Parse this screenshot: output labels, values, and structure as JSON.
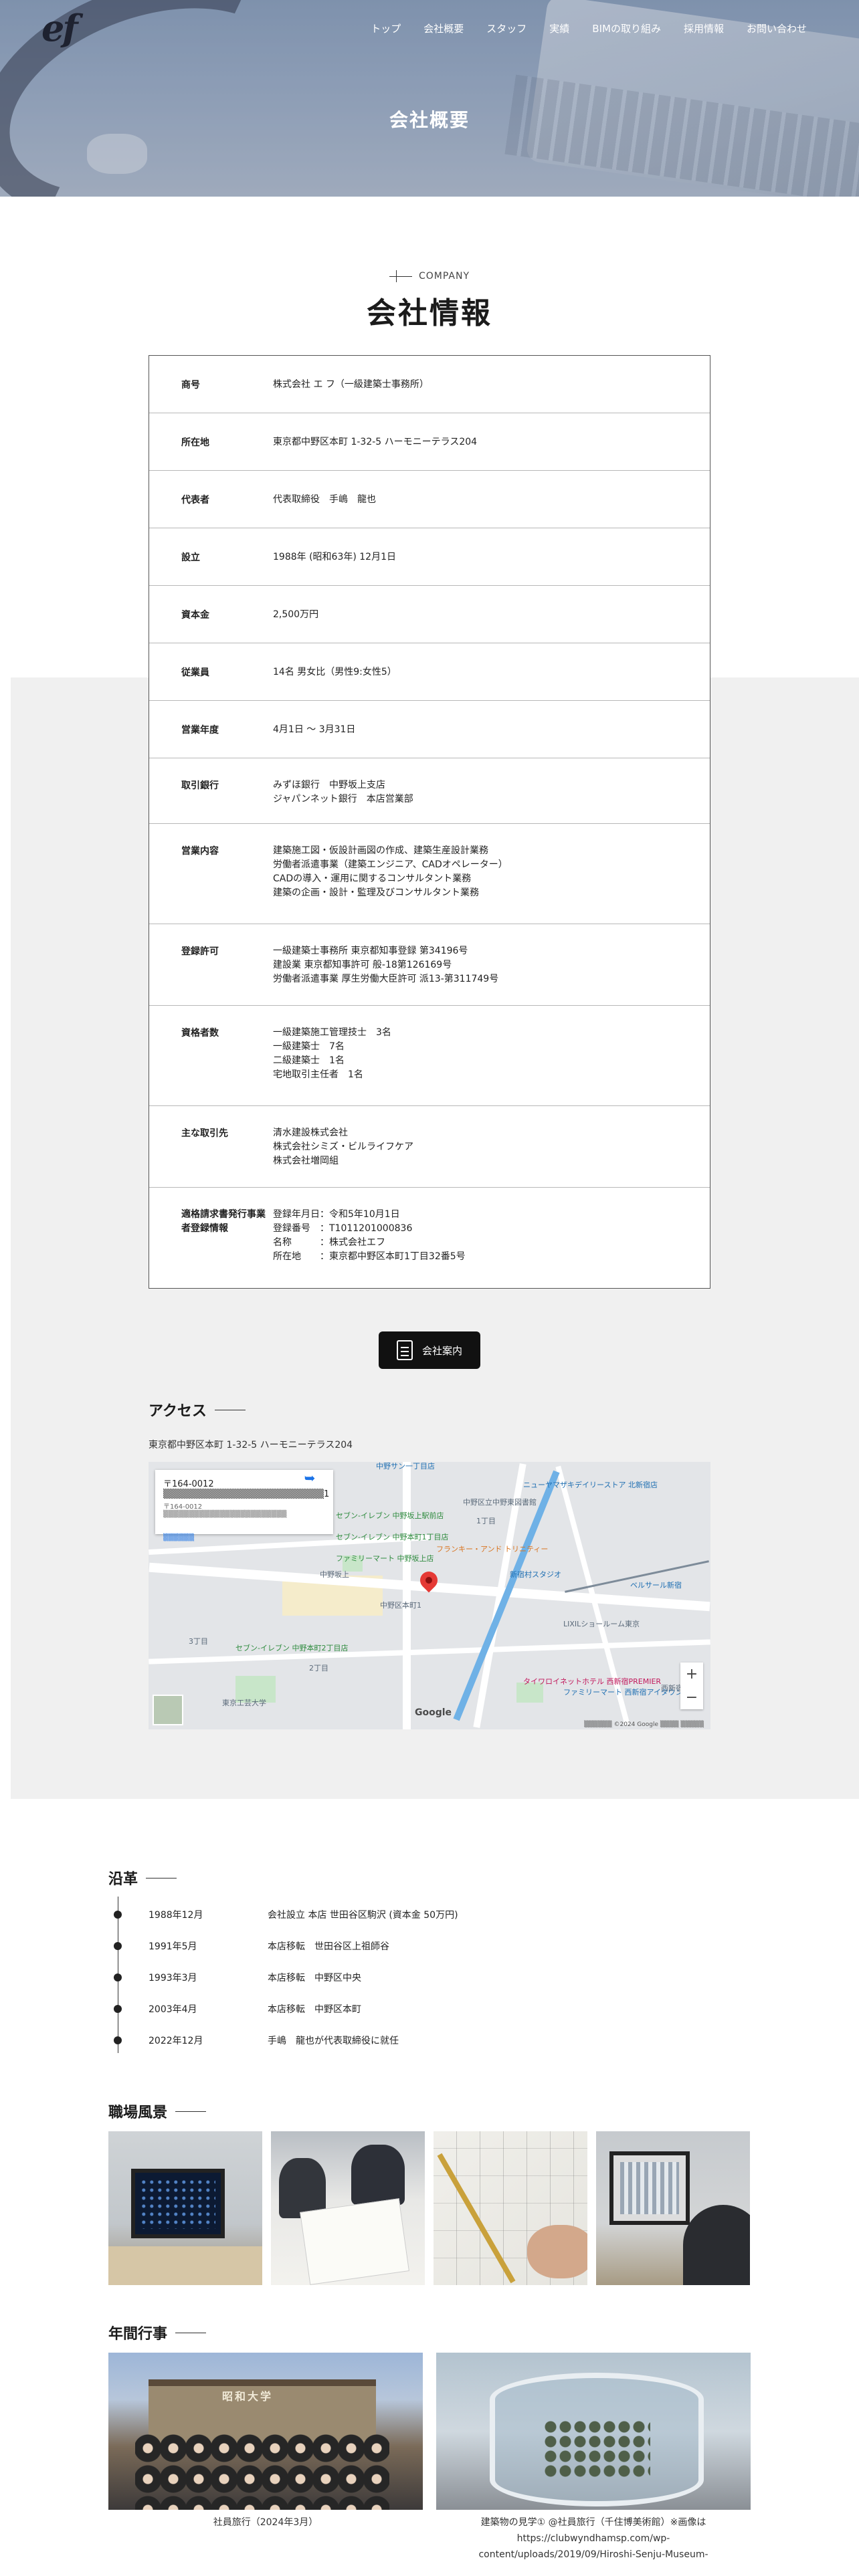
{
  "header": {
    "logo": "ef",
    "nav": [
      "トップ",
      "会社概要",
      "スタッフ",
      "実績",
      "BIMの取り組み",
      "採用情報",
      "お問い合わせ"
    ],
    "hero_title": "会社概要"
  },
  "company": {
    "eyebrow": "COMPANY",
    "title": "会社情報",
    "rows": [
      {
        "label": "商号",
        "lines": [
          "株式会社 エ フ（一級建築士事務所）"
        ]
      },
      {
        "label": "所在地",
        "lines": [
          "東京都中野区本町 1-32-5 ハーモニーテラス204"
        ]
      },
      {
        "label": "代表者",
        "lines": [
          "代表取締役　手嶋　龍也"
        ]
      },
      {
        "label": "設立",
        "lines": [
          "1988年 (昭和63年) 12月1日"
        ]
      },
      {
        "label": "資本金",
        "lines": [
          "2,500万円"
        ]
      },
      {
        "label": "従業員",
        "lines": [
          "14名 男女比（男性9:女性5）"
        ]
      },
      {
        "label": "営業年度",
        "lines": [
          "4月1日 ～ 3月31日"
        ]
      },
      {
        "label": "取引銀行",
        "lines": [
          "みずほ銀行　中野坂上支店",
          "ジャパンネット銀行　本店営業部"
        ]
      },
      {
        "label": "営業内容",
        "lines": [
          "建築施工図・仮設計画図の作成、建築生産設計業務",
          "労働者派遣事業（建築エンジニア、CADオペレーター）",
          "CADの導入・運用に関するコンサルタント業務",
          "建築の企画・設計・監理及びコンサルタント業務"
        ]
      },
      {
        "label": "登録許可",
        "lines": [
          "一級建築士事務所 東京都知事登録 第34196号",
          "建設業 東京都知事許可 般-18第126169号",
          "労働者派遣事業 厚生労働大臣許可 派13-第311749号"
        ]
      },
      {
        "label": "資格者数",
        "lines": [
          "一級建築施工管理技士　3名",
          "一級建築士　7名",
          "二級建築士　1名",
          "宅地取引主任者　1名"
        ]
      },
      {
        "label": "主な取引先",
        "lines": [
          "清水建設株式会社",
          "株式会社シミズ・ビルライフケア",
          "株式会社増岡組"
        ]
      },
      {
        "label": "適格請求書発行事業者登録情報",
        "lines": [
          "登録年月日：令和5年10月1日",
          "登録番号　：T1011201000836",
          "名称　　　：株式会社エフ",
          "所在地　　：東京都中野区本町1丁目32番5号"
        ]
      }
    ],
    "button_label": "会社案内"
  },
  "access": {
    "title": "アクセス",
    "address": "東京都中野区本町 1-32-5 ハーモニーテラス204",
    "map": {
      "card_title": "〒164-0012 ▒▒▒▒▒▒▒▒▒▒▒▒▒▒▒▒▒▒▒▒▒▒▒▒1",
      "card_sub": "〒164-0012 ▒▒▒▒▒▒▒▒▒▒▒▒▒▒▒▒▒▒▒▒▒▒▒▒",
      "card_link": "▒▒▒▒▒▒",
      "labels": [
        "中野サン一丁目店",
        "ニューヤマザキデイリーストア 北新宿店",
        "セブン-イレブン 中野坂上駅前店",
        "セブン-イレブン 中野本町1丁目店",
        "ファミリーマート 中野坂上店",
        "フランキー・アンド トリニティー",
        "中野坂上",
        "東京工芸大学",
        "タイワロイネットホテル 西新宿PREMIER",
        "ファミリーマート 西新宿アイタウン店",
        "ベルサール新宿",
        "中野区立中野東図書館",
        "新宿村スタジオ",
        "LIXILショールーム東京",
        "セブン-イレブン 中野本町2丁目店",
        "1丁目",
        "2丁目",
        "3丁目",
        "中野区本町1",
        "西新宿"
      ],
      "brand": "Google",
      "footer": "▒▒▒▒▒▒ ©2024 Google ▒▒▒▒ ▒▒▒▒▒"
    }
  },
  "history": {
    "title": "沿革",
    "items": [
      {
        "date": "1988年12月",
        "text": "会社設立 本店 世田谷区駒沢 (資本金 50万円)"
      },
      {
        "date": "1991年5月",
        "text": "本店移転　世田谷区上祖師谷"
      },
      {
        "date": "1993年3月",
        "text": "本店移転　中野区中央"
      },
      {
        "date": "2003年4月",
        "text": "本店移転　中野区本町"
      },
      {
        "date": "2022年12月",
        "text": "手嶋　龍也が代表取締役に就任"
      }
    ]
  },
  "workplace": {
    "title": "職場風景"
  },
  "events": {
    "title": "年間行事",
    "captions": [
      [
        "社員旅行（2024年3月）"
      ],
      [
        "建築物の見学① @社員旅行（千住博美術館）※画像は",
        "https://clubwyndhamsp.com/wp-",
        "content/uploads/2019/09/Hiroshi-Senju-Museum-"
      ]
    ],
    "photo_sign": "昭和大学"
  }
}
